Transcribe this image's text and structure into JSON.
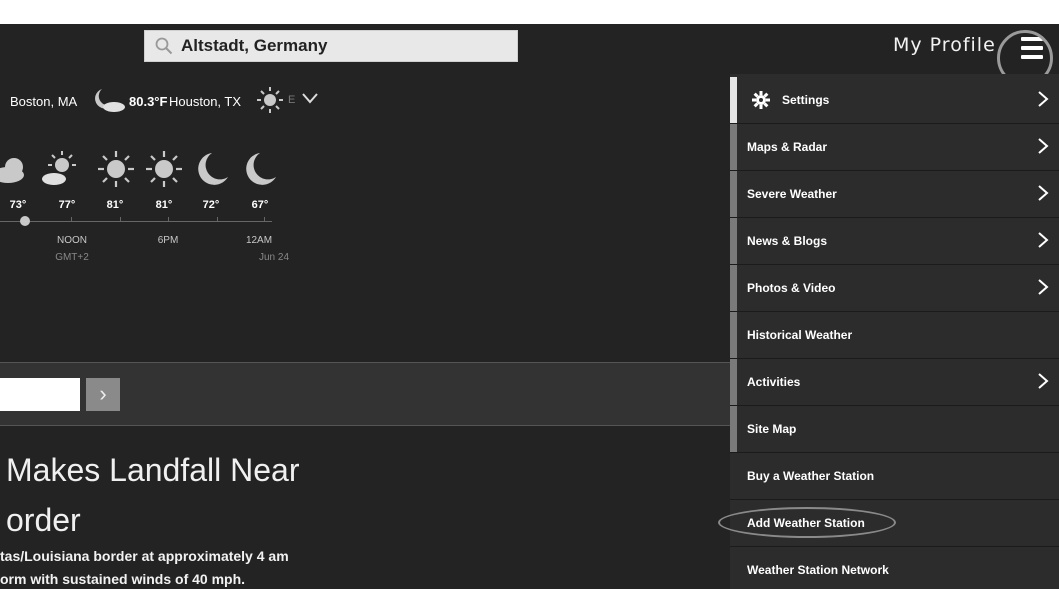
{
  "header": {
    "search_value": "Altstadt, Germany",
    "profile_label": "My Profile",
    "menu_icon": "hamburger-icon"
  },
  "ticker": {
    "city1": "Boston, MA",
    "city1_icon": "moon-cloud-icon",
    "temp2": "80.3°F",
    "city2": "Houston, TX",
    "city2_icon": "sun-icon",
    "more_fragment": "E",
    "expand_icon": "chevron-down-icon"
  },
  "hourly": {
    "temps": [
      "73°",
      "77°",
      "81°",
      "81°",
      "72°",
      "67°"
    ],
    "icons": [
      "cloud-icon",
      "sun-cloud-icon",
      "sun-icon",
      "sun-icon",
      "moon-icon",
      "moon-icon"
    ],
    "labels": [
      {
        "time": "NOON",
        "sub": "GMT+2"
      },
      {
        "time": "6PM",
        "sub": ""
      },
      {
        "time": "12AM",
        "sub": "Jun 24"
      }
    ]
  },
  "band": {
    "go_glyph": "›"
  },
  "article": {
    "headline1": "Makes Landfall Near",
    "headline2": "order",
    "line1": "tas/Louisiana border at approximately 4 am",
    "line2": "orm with sustained winds of 40 mph."
  },
  "menu": {
    "items": [
      {
        "label": "Settings",
        "arrow": true,
        "icon": "gear-icon"
      },
      {
        "label": "Maps & Radar",
        "arrow": true
      },
      {
        "label": "Severe Weather",
        "arrow": true
      },
      {
        "label": "News & Blogs",
        "arrow": true
      },
      {
        "label": "Photos & Video",
        "arrow": true
      },
      {
        "label": "Historical Weather",
        "arrow": false
      },
      {
        "label": "Activities",
        "arrow": true
      },
      {
        "label": "Site Map",
        "arrow": false
      },
      {
        "label": "Buy a Weather Station",
        "arrow": false
      },
      {
        "label": "Add Weather Station",
        "arrow": false
      },
      {
        "label": "Weather Station Network",
        "arrow": false
      }
    ]
  },
  "colors": {
    "background": "#232323",
    "menu_bg": "#2c2c2c",
    "accent_bar": "#7a7a7a",
    "annotation": "#9a9a9a"
  }
}
